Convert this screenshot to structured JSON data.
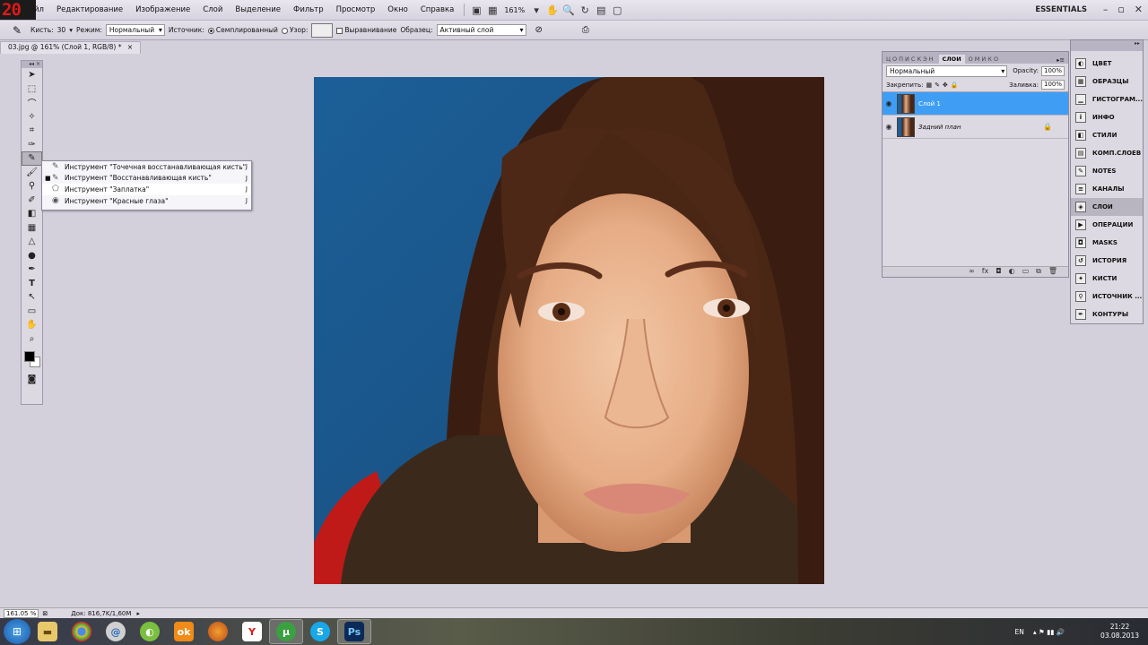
{
  "app": {
    "logo_text": "20"
  },
  "menu": [
    "йл",
    "Редактирование",
    "Изображение",
    "Слой",
    "Выделение",
    "Фильтр",
    "Просмотр",
    "Окно",
    "Справка"
  ],
  "menubar": {
    "zoom": "161%",
    "workspace": "ESSENTIALS"
  },
  "options": {
    "brush_label": "Кисть:",
    "brush_size": "30",
    "mode_label": "Режим:",
    "mode_value": "Нормальный",
    "source_label": "Источник:",
    "source_sampled": "Семплированный",
    "source_pattern": "Узор:",
    "aligned_label": "Выравнивание",
    "sample_label": "Образец:",
    "sample_value": "Активный слой"
  },
  "document": {
    "tab_title": "03.jpg @ 161% (Слой 1, RGB/8) *"
  },
  "flyout": {
    "items": [
      {
        "label": "Инструмент \"Точечная восстанавливающая кисть\"",
        "key": "J",
        "bullet": ""
      },
      {
        "label": "Инструмент \"Восстанавливающая кисть\"",
        "key": "J",
        "bullet": "■"
      },
      {
        "label": "Инструмент \"Заплатка\"",
        "key": "J",
        "bullet": ""
      },
      {
        "label": "Инструмент \"Красные глаза\"",
        "key": "J",
        "bullet": ""
      }
    ]
  },
  "layers_panel": {
    "tabs": [
      "ЦОПИСКЭН",
      "СЛОИ",
      "ОМИКО"
    ],
    "blend_mode": "Нормальный",
    "opacity_label": "Opacity:",
    "opacity_value": "100%",
    "lock_label": "Закрепить:",
    "fill_label": "Заливка:",
    "fill_value": "100%",
    "layers": [
      {
        "name": "Слой 1",
        "selected": true
      },
      {
        "name": "Задний план",
        "selected": false
      }
    ]
  },
  "dock": {
    "items": [
      "ЦВЕТ",
      "ОБРАЗЦЫ",
      "ГИСТОГРАМ...",
      "ИНФО",
      "СТИЛИ",
      "КОМП.СЛОЕВ",
      "NOTES",
      "КАНАЛЫ",
      "СЛОИ",
      "ОПЕРАЦИИ",
      "MASKS",
      "ИСТОРИЯ",
      "КИСТИ",
      "ИСТОЧНИК ...",
      "КОНТУРЫ"
    ],
    "active": "СЛОИ"
  },
  "status": {
    "zoom": "161.05 %",
    "doc": "Док: 816,7K/1,60M"
  },
  "taskbar": {
    "lang": "EN",
    "time": "21:22",
    "date": "03.08.2013"
  },
  "colors": {
    "selection_blue": "#3f9ef3",
    "backdrop_blue": "#1f5e94",
    "logo_red": "#e01818"
  }
}
